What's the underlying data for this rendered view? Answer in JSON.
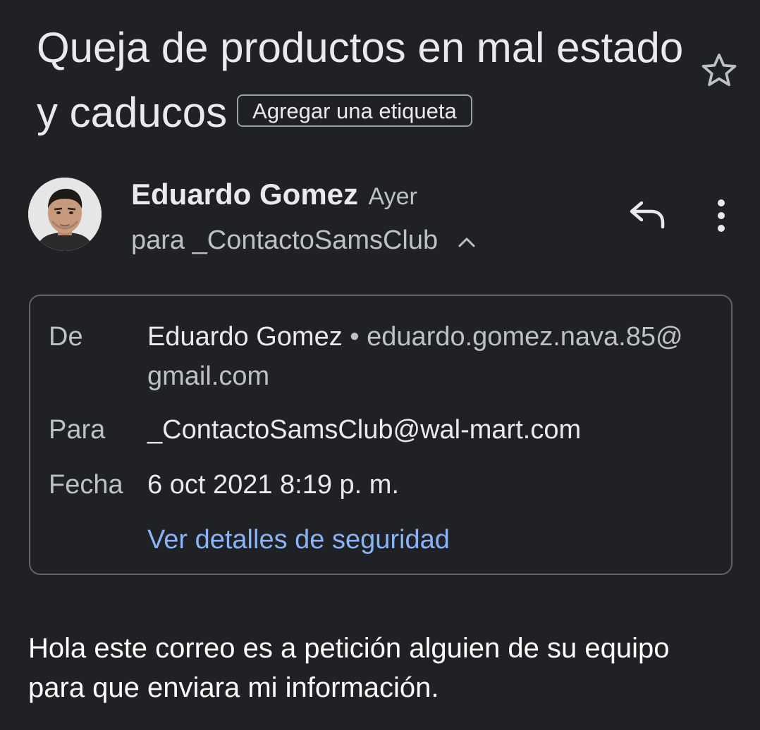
{
  "email": {
    "subject": "Queja de productos en mal estado y caducos",
    "label_chip": "Agregar una etiqueta",
    "star_icon": "star-outline-icon",
    "sender": {
      "name": "Eduardo Gomez",
      "time": "Ayer",
      "recipient_summary": "para _ContactoSamsClub"
    },
    "actions": {
      "reply_icon": "reply-icon",
      "more_icon": "more-vert-icon"
    },
    "details": {
      "from_label": "De",
      "from_name": "Eduardo Gomez",
      "from_separator": "•",
      "from_email": "eduardo.gomez.nava.85@gmail.com",
      "to_label": "Para",
      "to_value": "_ContactoSamsClub@wal-mart.com",
      "date_label": "Fecha",
      "date_value": "6 oct 2021 8:19 p. m.",
      "security_link": "Ver detalles de seguridad"
    },
    "body": "Hola este correo es a petición alguien de su equipo para que enviara mi información."
  },
  "colors": {
    "background": "#202124",
    "text": "#e8eaed",
    "secondary": "#bdc1c6",
    "link": "#8ab4f8",
    "border": "#5f6368"
  }
}
